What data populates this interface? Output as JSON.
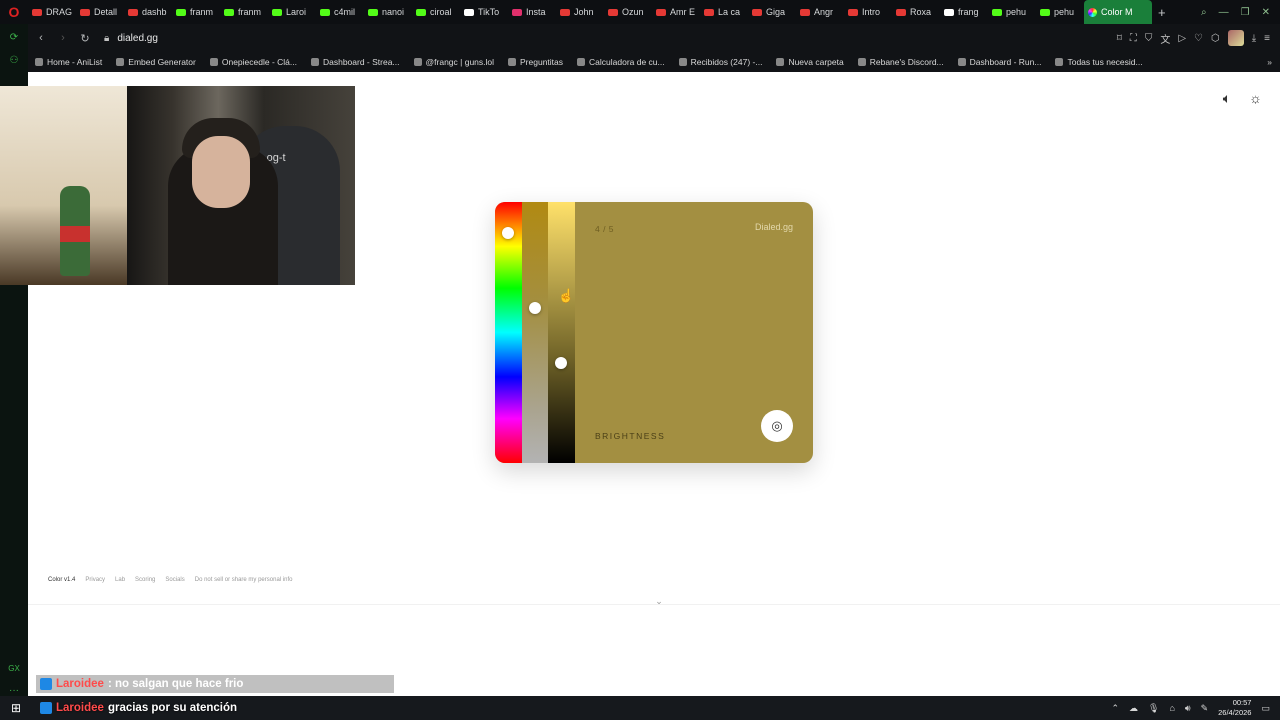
{
  "browser": {
    "tabs": [
      {
        "label": "DRAG",
        "icon": "youtube-icon",
        "color": "#e53935"
      },
      {
        "label": "Detall",
        "icon": "youtube-icon",
        "color": "#e53935"
      },
      {
        "label": "dashb",
        "icon": "youtube-icon",
        "color": "#e53935"
      },
      {
        "label": "franm",
        "icon": "kick-icon",
        "color": "#53fc18"
      },
      {
        "label": "franm",
        "icon": "kick-icon",
        "color": "#53fc18"
      },
      {
        "label": "Laroi",
        "icon": "kick-icon",
        "color": "#53fc18"
      },
      {
        "label": "c4mil",
        "icon": "kick-icon",
        "color": "#53fc18"
      },
      {
        "label": "nanoi",
        "icon": "kick-icon",
        "color": "#53fc18"
      },
      {
        "label": "ciroal",
        "icon": "kick-icon",
        "color": "#53fc18"
      },
      {
        "label": "TikTo",
        "icon": "tiktok-icon",
        "color": "#ffffff"
      },
      {
        "label": "Insta",
        "icon": "instagram-icon",
        "color": "#e1306c"
      },
      {
        "label": "John",
        "icon": "youtube-icon",
        "color": "#e53935"
      },
      {
        "label": "Ozun",
        "icon": "youtube-icon",
        "color": "#e53935"
      },
      {
        "label": "Amr E",
        "icon": "youtube-icon",
        "color": "#e53935"
      },
      {
        "label": "La ca",
        "icon": "youtube-icon",
        "color": "#e53935"
      },
      {
        "label": "Giga",
        "icon": "youtube-icon",
        "color": "#e53935"
      },
      {
        "label": "Angr",
        "icon": "youtube-icon",
        "color": "#e53935"
      },
      {
        "label": "Intro",
        "icon": "youtube-icon",
        "color": "#e53935"
      },
      {
        "label": "Roxa",
        "icon": "youtube-icon",
        "color": "#e53935"
      },
      {
        "label": "frang",
        "icon": "tiktok-icon",
        "color": "#ffffff"
      },
      {
        "label": "pehu",
        "icon": "kick-icon",
        "color": "#53fc18"
      },
      {
        "label": "pehu",
        "icon": "kick-icon",
        "color": "#53fc18"
      }
    ],
    "active_tab": {
      "label": "Color M",
      "icon": "color-wheel-icon"
    },
    "new_tab": "+",
    "url": "dialed.gg",
    "bookmarks": [
      "Home - AniList",
      "Embed Generator",
      "Onepiecedle - Clá...",
      "Dashboard - Strea...",
      "@frangc | guns.lol",
      "Preguntitas",
      "Calculadora de cu...",
      "Recibidos (247) -...",
      "Nueva carpeta",
      "Rebane's Discord...",
      "Dashboard - Run...",
      "Todas tus necesid..."
    ]
  },
  "page": {
    "card": {
      "step": "4 / 5",
      "brand": "Dialed.gg",
      "slider_label": "BRIGHTNESS",
      "color": "#a38f41"
    },
    "footer": {
      "version": "Color v1.4",
      "links": [
        "Privacy",
        "Lab",
        "Scoring",
        "Socials",
        "Do not sell or share my personal info"
      ]
    }
  },
  "webcam": {
    "chair_logo": "·og-t"
  },
  "chat": [
    {
      "user": "Laroidee",
      "message": ": no salgan que hace frio"
    },
    {
      "user": "Laroidee",
      "message": "gracias por su atención"
    }
  ],
  "taskbar": {
    "time": "00:57",
    "date": "26/4/2026"
  }
}
